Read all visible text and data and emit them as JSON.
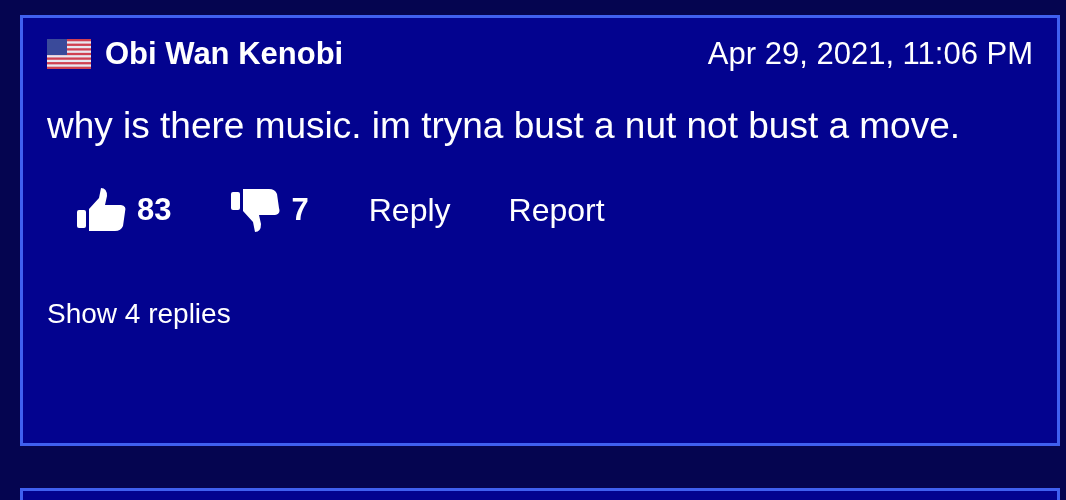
{
  "comments": [
    {
      "author": "Obi Wan Kenobi",
      "date": "Apr 29, 2021, 11:06 PM",
      "text": "why is there music. im tryna bust a nut not bust a move.",
      "likes": "83",
      "dislikes": "7",
      "reply": "Reply",
      "report": "Report",
      "show_replies": "Show 4 replies"
    }
  ]
}
